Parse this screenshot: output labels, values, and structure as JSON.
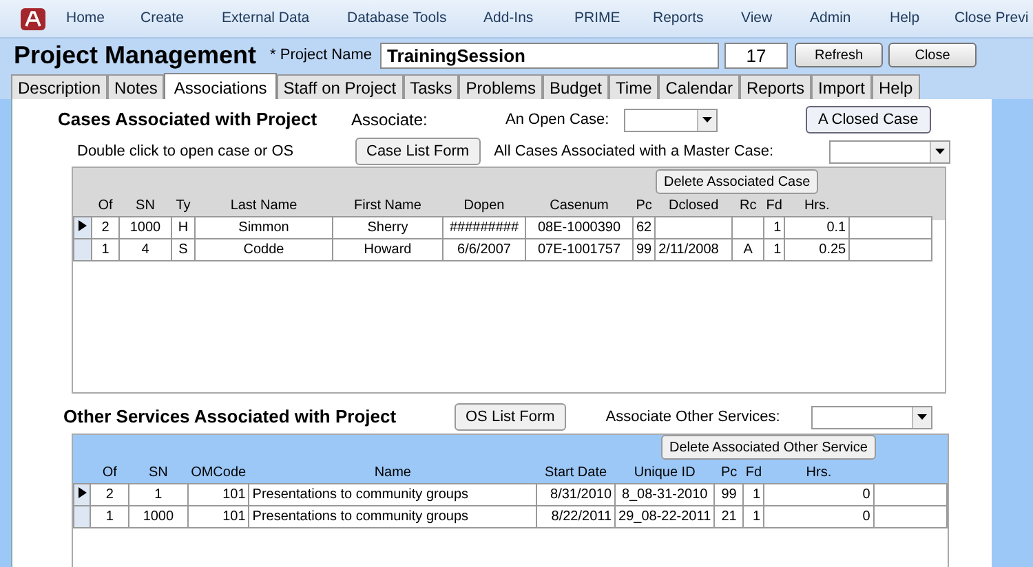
{
  "menu": [
    "Home",
    "Create",
    "External Data",
    "Database Tools",
    "Add-Ins",
    "PRIME",
    "Reports",
    "View",
    "Admin",
    "Help",
    "Close Previ"
  ],
  "header": {
    "title": "Project Management",
    "name_label": "* Project Name",
    "name_value": "TrainingSession",
    "number": "17",
    "buttons": [
      "Refresh",
      "Close"
    ]
  },
  "tabs": [
    {
      "label": "Description",
      "selected": false
    },
    {
      "label": "Notes",
      "selected": false
    },
    {
      "label": "Associations",
      "selected": true
    },
    {
      "label": "Staff on Project",
      "selected": false
    },
    {
      "label": "Tasks",
      "selected": false
    },
    {
      "label": "Problems",
      "selected": false
    },
    {
      "label": "Budget",
      "selected": false
    },
    {
      "label": "Time",
      "selected": false
    },
    {
      "label": "Calendar",
      "selected": false
    },
    {
      "label": "Reports",
      "selected": false
    },
    {
      "label": "Import",
      "selected": false
    },
    {
      "label": "Help",
      "selected": false
    }
  ],
  "cases": {
    "title": "Cases Associated with Project",
    "associate_label": "Associate:",
    "open_case_label": "An Open Case:",
    "closed_case_button": "A Closed Case",
    "hint": "Double click to open case or OS",
    "list_button": "Case List Form",
    "master_label": "All Cases Associated with a Master Case:",
    "delete_button": "Delete Associated Case",
    "columns": [
      "Of",
      "SN",
      "Ty",
      "Last Name",
      "First Name",
      "Dopen",
      "Casenum",
      "Pc",
      "Dclosed",
      "Rc",
      "Fd",
      "Hrs."
    ],
    "rows": [
      {
        "selected": true,
        "cells": [
          "2",
          "1000",
          "H",
          "Simmon",
          "Sherry",
          "#########",
          "08E-1000390",
          "62",
          "",
          "",
          "1",
          "0.1"
        ]
      },
      {
        "selected": false,
        "cells": [
          "1",
          "4",
          "S",
          "Codde",
          "Howard",
          "6/6/2007",
          "07E-1001757",
          "99",
          "2/11/2008",
          "A",
          "1",
          "0.25"
        ]
      }
    ]
  },
  "services": {
    "title": "Other Services Associated with Project",
    "list_button": "OS List Form",
    "associate_label": "Associate Other Services:",
    "delete_button": "Delete Associated Other Service",
    "columns": [
      "Of",
      "SN",
      "OMCode",
      "Name",
      "Start Date",
      "Unique ID",
      "Pc",
      "Fd",
      "Hrs."
    ],
    "rows": [
      {
        "selected": true,
        "cells": [
          "2",
          "1",
          "101",
          "Presentations to community groups",
          "8/31/2010",
          "8_08-31-2010",
          "99",
          "1",
          "0"
        ]
      },
      {
        "selected": false,
        "cells": [
          "1",
          "1000",
          "101",
          "Presentations to community groups",
          "8/22/2011",
          "29_08-22-2011",
          "21",
          "1",
          "0"
        ]
      }
    ]
  }
}
